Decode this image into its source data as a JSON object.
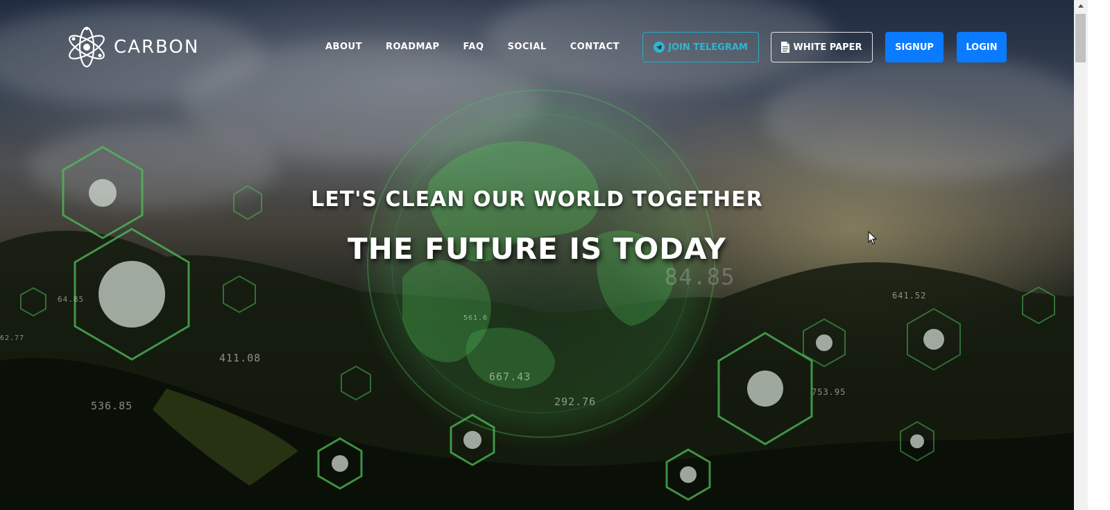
{
  "brand": {
    "name": "CARBON",
    "logo_icon": "atom-icon"
  },
  "nav": {
    "items": [
      {
        "label": "ABOUT"
      },
      {
        "label": "ROADMAP"
      },
      {
        "label": "FAQ"
      },
      {
        "label": "SOCIAL"
      },
      {
        "label": "CONTACT"
      }
    ]
  },
  "buttons": {
    "telegram": {
      "label": "JOIN TELEGRAM",
      "icon": "telegram-icon",
      "color": "#2fb5d2"
    },
    "whitepaper": {
      "label": "WHITE PAPER",
      "icon": "document-icon"
    },
    "signup": {
      "label": "SIGNUP",
      "color": "#0a7bff"
    },
    "login": {
      "label": "LOGIN",
      "color": "#0a7bff"
    }
  },
  "hero": {
    "tagline": "LET'S CLEAN OUR WORLD TOGETHER",
    "headline": "THE FUTURE IS TODAY"
  },
  "decor": {
    "numbers": [
      "64.85",
      "411.08",
      "536.85",
      "667.43",
      "292.76",
      "641.52",
      "753.95",
      "561.6",
      "84.85",
      "62.77"
    ],
    "accent_color": "#4fbf5a"
  }
}
